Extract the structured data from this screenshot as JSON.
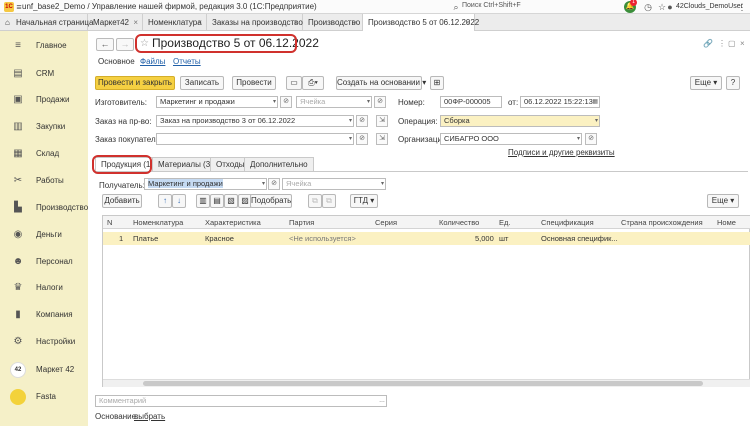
{
  "app": {
    "logo": "1С",
    "title": "unf_base2_Demo / Управление нашей фирмой, редакция 3.0  (1С:Предприятие)",
    "search_placeholder": "Поиск Ctrl+Shift+F",
    "notification_count": "1",
    "user": "42Clouds_DemoUser"
  },
  "tabs": [
    {
      "label": "Начальная страница"
    },
    {
      "label": "Маркет42"
    },
    {
      "label": "Номенклатура"
    },
    {
      "label": "Заказы на производство"
    },
    {
      "label": "Производство"
    },
    {
      "label": "Производство 5 от 06.12.2022"
    }
  ],
  "sidebar": [
    {
      "label": "Главное",
      "icon": "menu-icon"
    },
    {
      "label": "CRM",
      "icon": "crm-icon"
    },
    {
      "label": "Продажи",
      "icon": "sales-icon"
    },
    {
      "label": "Закупки",
      "icon": "purchases-icon"
    },
    {
      "label": "Склад",
      "icon": "warehouse-icon"
    },
    {
      "label": "Работы",
      "icon": "works-icon"
    },
    {
      "label": "Производство",
      "icon": "production-icon"
    },
    {
      "label": "Деньги",
      "icon": "money-icon"
    },
    {
      "label": "Персонал",
      "icon": "staff-icon"
    },
    {
      "label": "Налоги",
      "icon": "taxes-icon"
    },
    {
      "label": "Компания",
      "icon": "company-icon"
    },
    {
      "label": "Настройки",
      "icon": "settings-icon"
    },
    {
      "label": "Маркет 42",
      "badge": "42"
    },
    {
      "label": "Fasta"
    }
  ],
  "doc": {
    "title": "Производство 5 от 06.12.2022",
    "subtabs": {
      "main": "Основное",
      "files": "Файлы",
      "reports": "Отчеты"
    },
    "toolbar": {
      "post_close": "Провести и закрыть",
      "save": "Записать",
      "post": "Провести",
      "create_based": "Создать на основании",
      "more": "Еще"
    },
    "fields": {
      "maker_label": "Изготовитель:",
      "maker_value": "Маркетинг и продажи",
      "cell_placeholder": "Ячейка",
      "order_label": "Заказ на пр-во:",
      "order_value": "Заказ на производство 3 от 06.12.2022",
      "buyer_order_label": "Заказ покупателя:",
      "number_label": "Номер:",
      "number_value": "00ФР-000005",
      "from_label": "от:",
      "date_value": "06.12.2022 15:22:13",
      "operation_label": "Операция:",
      "operation_value": "Сборка",
      "org_label": "Организация:",
      "org_value": "СИБАГРО ООО",
      "signatures_link": "Подписи и другие реквизиты"
    },
    "form_tabs": {
      "products": "Продукция (1)",
      "materials": "Материалы (3)",
      "waste": "Отходы",
      "extra": "Дополнительно"
    },
    "recipient_label": "Получатель:",
    "recipient_value": "Маркетинг и продажи",
    "grid_toolbar": {
      "add": "Добавить",
      "pick": "Подобрать",
      "gtd": "ГТД",
      "more": "Еще"
    },
    "columns": [
      "N",
      "Номенклатура",
      "Характеристика",
      "Партия",
      "Серия",
      "Количество",
      "Ед.",
      "Спецификация",
      "Страна происхождения",
      "Номе"
    ],
    "rows": [
      {
        "n": "1",
        "item": "Платье",
        "char": "Красное",
        "batch": "<Не используется>",
        "series": "",
        "qty": "5,000",
        "unit": "шт",
        "spec": "Основная специфик...",
        "country": ""
      }
    ],
    "comment_placeholder": "Комментарий",
    "basis_label": "Основание:",
    "basis_link": "выбрать"
  }
}
